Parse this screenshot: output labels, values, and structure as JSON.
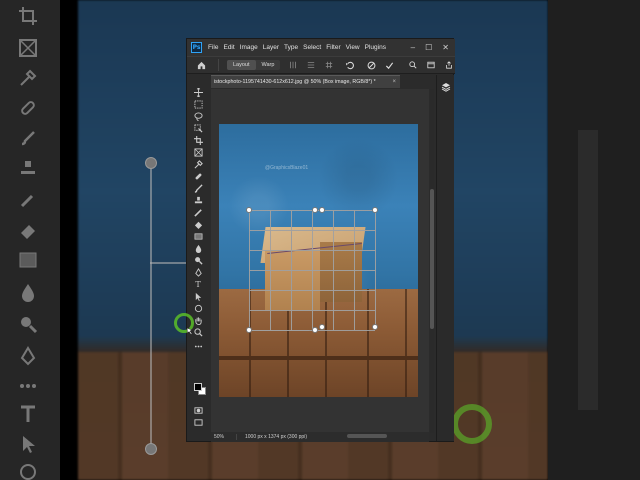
{
  "app": {
    "logo": "Ps",
    "menu": [
      "File",
      "Edit",
      "Image",
      "Layer",
      "Type",
      "Select",
      "Filter",
      "View",
      "Plugins"
    ],
    "window_controls": {
      "minimize": "–",
      "maximize": "☐",
      "close": "✕"
    }
  },
  "options_bar": {
    "modes": [
      {
        "label": "Layout"
      },
      {
        "label": "Warp"
      }
    ]
  },
  "document": {
    "tab_title": "istockphoto-1195741430-612x612.jpg @ 50% (Box image, RGB/8*) *",
    "close": "×",
    "watermark": "@GraphicsBlaze01"
  },
  "status": {
    "zoom": "50%",
    "info": "1000 px x 1374 px (300 ppi)"
  },
  "colors": {
    "accent": "#2fa3f7",
    "ring": "#5abe28",
    "app_bg": "#2b2b2b"
  },
  "icons": {
    "tools": [
      "move-icon",
      "marquee-icon",
      "lasso-icon",
      "object-select-icon",
      "crop-icon",
      "frame-icon",
      "eyedropper-icon",
      "healing-icon",
      "brush-icon",
      "stamp-icon",
      "history-brush-icon",
      "eraser-icon",
      "gradient-icon",
      "blur-icon",
      "dodge-icon",
      "pen-icon",
      "type-icon",
      "path-select-icon",
      "ellipse-icon",
      "hand-icon",
      "zoom-icon"
    ]
  }
}
